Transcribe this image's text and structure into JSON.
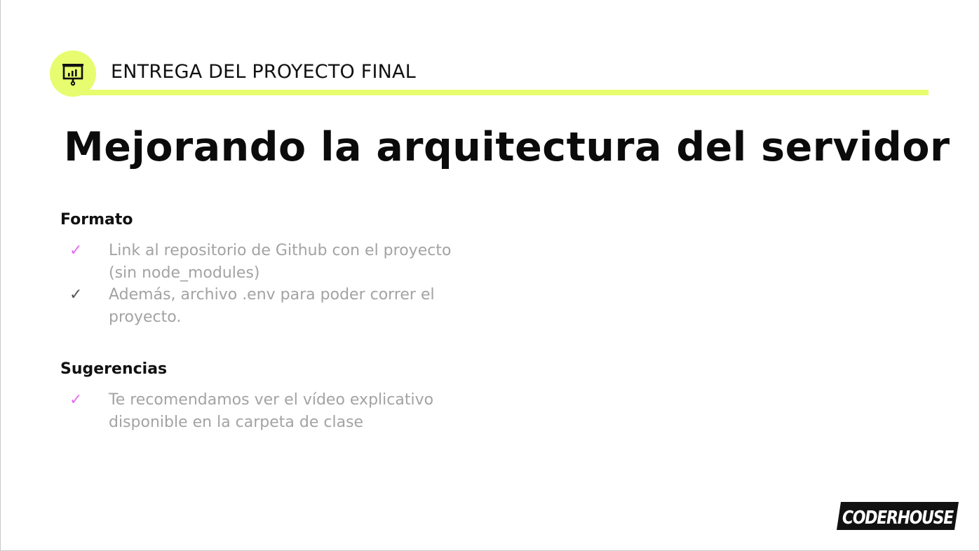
{
  "header": {
    "section_label": "ENTREGA DEL PROYECTO FINAL",
    "icon": "presentation-board-icon",
    "accent_color": "#e7fd6f"
  },
  "title": "Mejorando la arquitectura del servidor",
  "formato": {
    "heading": "Formato",
    "items": [
      {
        "check": "✓",
        "check_color": "#e36ef0",
        "text": "Link al repositorio de Github con el proyecto (sin node_modules)"
      },
      {
        "check": "✓",
        "check_color": "#555555",
        "text": "Además, archivo .env para poder correr el proyecto."
      }
    ]
  },
  "sugerencias": {
    "heading": "Sugerencias",
    "items": [
      {
        "check": "✓",
        "check_color": "#e36ef0",
        "text": "Te recomendamos ver el vídeo explicativo disponible en la carpeta de clase"
      }
    ]
  },
  "logo": {
    "text": "CODERHOUSE"
  }
}
